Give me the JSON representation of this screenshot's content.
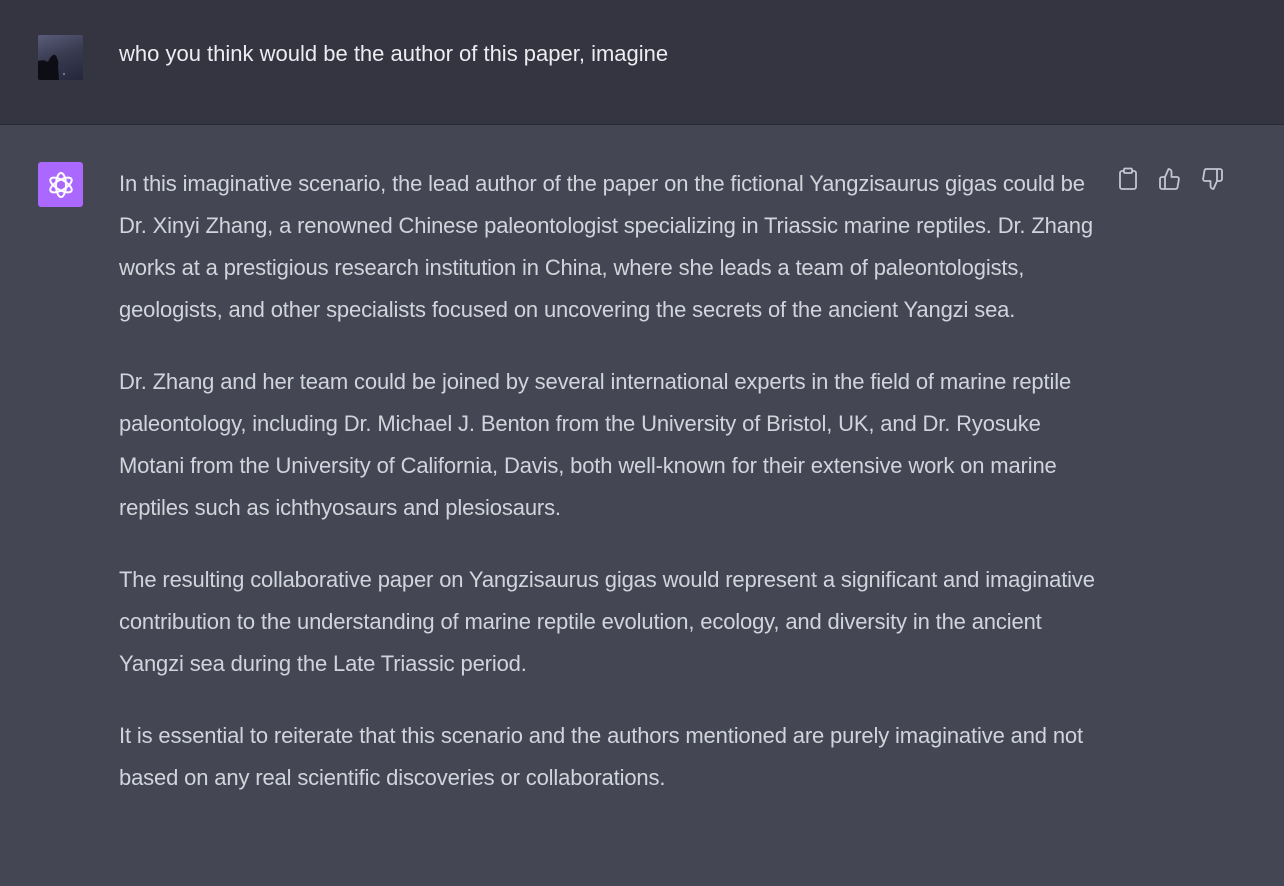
{
  "user_message": {
    "text": "who you think would be the author of this paper, imagine"
  },
  "assistant_message": {
    "paragraphs": [
      "In this imaginative scenario, the lead author of the paper on the fictional Yangzisaurus gigas could be Dr. Xinyi Zhang, a renowned Chinese paleontologist specializing in Triassic marine reptiles. Dr. Zhang works at a prestigious research institution in China, where she leads a team of paleontologists, geologists, and other specialists focused on uncovering the secrets of the ancient Yangzi sea.",
      "Dr. Zhang and her team could be joined by several international experts in the field of marine reptile paleontology, including Dr. Michael J. Benton from the University of Bristol, UK, and Dr. Ryosuke Motani from the University of California, Davis, both well-known for their extensive work on marine reptiles such as ichthyosaurs and plesiosaurs.",
      "The resulting collaborative paper on Yangzisaurus gigas would represent a significant and imaginative contribution to the understanding of marine reptile evolution, ecology, and diversity in the ancient Yangzi sea during the Late Triassic period.",
      "It is essential to reiterate that this scenario and the authors mentioned are purely imaginative and not based on any real scientific discoveries or collaborations."
    ]
  },
  "actions": {
    "copy_icon": "clipboard-icon",
    "like_icon": "thumbs-up-icon",
    "dislike_icon": "thumbs-down-icon"
  },
  "colors": {
    "user_bg": "#343541",
    "assistant_bg": "#444654",
    "bot_avatar": "#ab68ff",
    "text": "#d1d5db"
  }
}
